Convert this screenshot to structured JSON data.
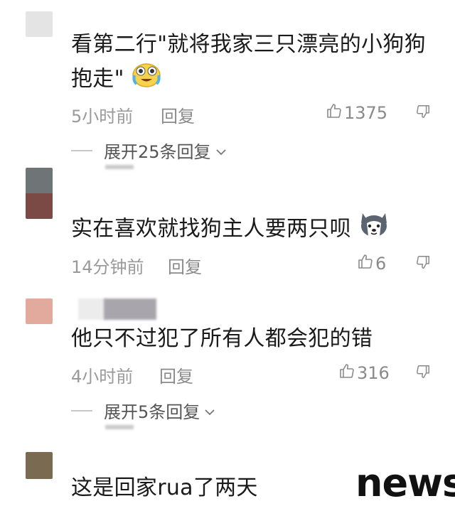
{
  "comments": [
    {
      "text": "看第二行\"就将我家三只漂亮的小狗狗",
      "text_line2": "抱走\"",
      "emoji": "crying-laughing-emoji",
      "time": "5小时前",
      "reply_label": "回复",
      "likes": "1375",
      "expand_label": "展开25条回复",
      "avatar_colors": [
        "#e4e4e4"
      ]
    },
    {
      "text": "实在喜欢就找狗主人要两只呗",
      "emoji": "husky-dog-emoji",
      "time": "14分钟前",
      "reply_label": "回复",
      "likes": "6",
      "avatar_colors": [
        "#6f7476",
        "#7b4a44"
      ]
    },
    {
      "text": "他只不过犯了所有人都会犯的错",
      "time": "4小时前",
      "reply_label": "回复",
      "likes": "316",
      "expand_label": "展开5条回复",
      "avatar_colors": [
        "#e2aa9c"
      ],
      "username_blur_colors": [
        "#ececec",
        "#a8a6ac"
      ]
    },
    {
      "text": "这是回家rua了两天",
      "avatar_colors": [
        "#7a6a52"
      ]
    }
  ],
  "watermark": "news",
  "colors": {
    "text": "#1a1a1a",
    "meta": "#9a9a9a",
    "icon": "#8a8a8a"
  }
}
